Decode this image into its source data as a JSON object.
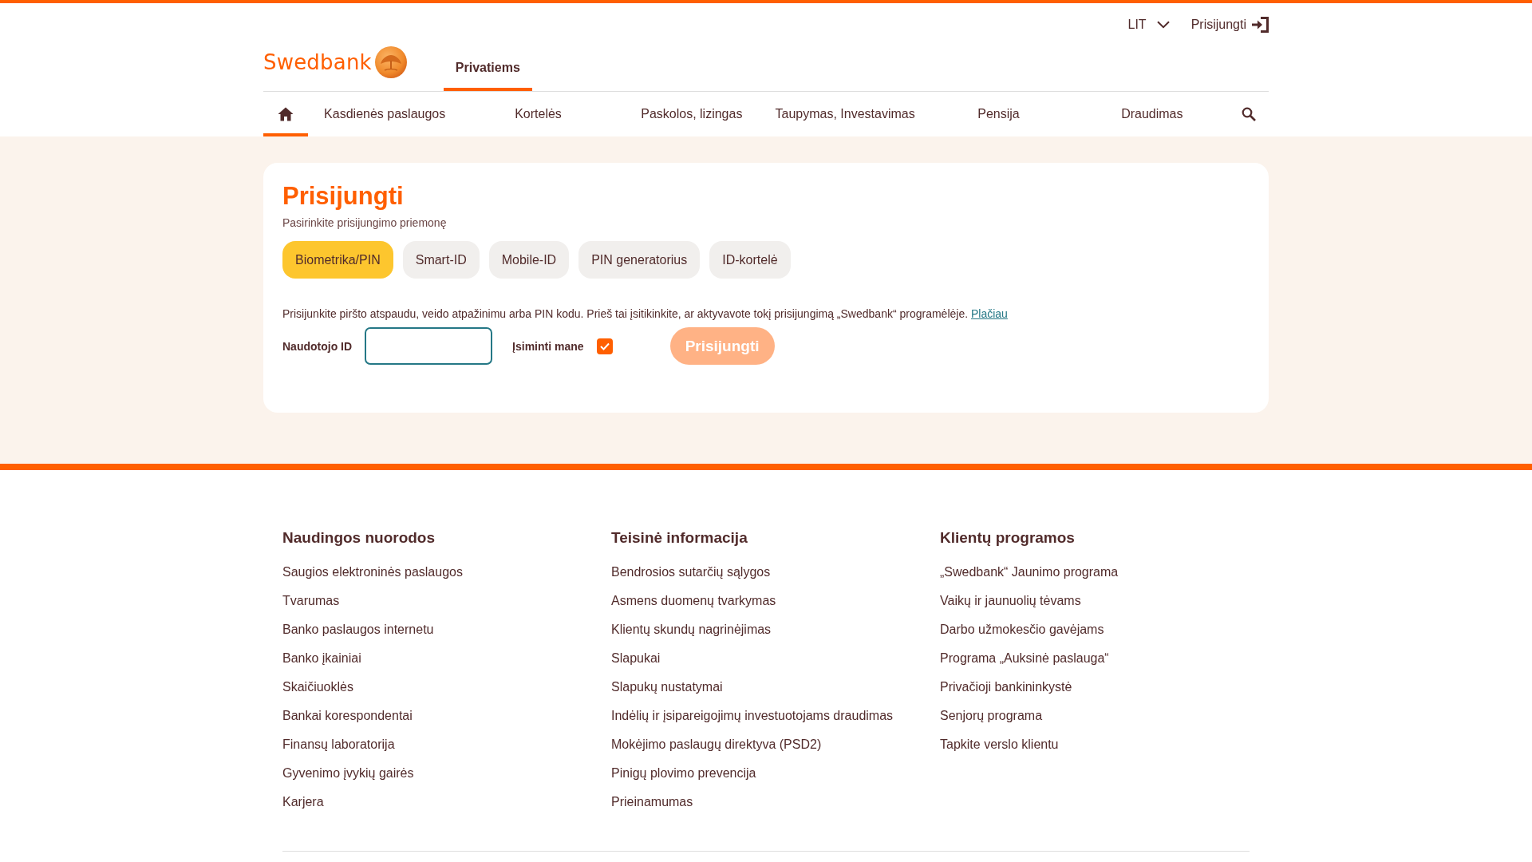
{
  "top_bar": {
    "language": "LIT",
    "login_link": "Prisijungti"
  },
  "brand": {
    "logo_text": "Swedbank"
  },
  "segment_tabs": [
    {
      "label": "Privatiems",
      "selected": true
    }
  ],
  "main_nav": {
    "home": {
      "selected": true
    },
    "items": [
      {
        "label": "Kasdienės paslaugos",
        "selected": false
      },
      {
        "label": "Kortelės",
        "selected": false
      },
      {
        "label": "Paskolos, lizingas",
        "selected": false
      },
      {
        "label": "Taupymas, Investavimas",
        "selected": false
      },
      {
        "label": "Pensija",
        "selected": false
      },
      {
        "label": "Draudimas",
        "selected": false
      }
    ]
  },
  "login": {
    "title": "Prisijungti",
    "subtitle": "Pasirinkite prisijungimo priemonę",
    "methods": [
      {
        "label": "Biometrika/PIN",
        "selected": true
      },
      {
        "label": "Smart-ID",
        "selected": false
      },
      {
        "label": "Mobile-ID",
        "selected": false
      },
      {
        "label": "PIN generatorius",
        "selected": false
      },
      {
        "label": "ID-kortelė",
        "selected": false
      }
    ],
    "description": "Prisijunkite piršto atspaudu, veido atpažinimu arba PIN kodu. Prieš tai įsitikinkite, ar aktyvavote tokį prisijungimą „Swedbank“ programėlėje.",
    "more_link": "Plačiau",
    "user_id": {
      "label": "Naudotojo ID"
    },
    "remember": {
      "label": "Įsiminti mane",
      "checked": true
    },
    "submit": {
      "label": "Prisijungti",
      "disabled": true
    }
  },
  "footer": {
    "columns": [
      {
        "title": "Naudingos nuorodos",
        "links": [
          "Saugios elektroninės paslaugos",
          "Tvarumas",
          "Banko paslaugos internetu",
          "Banko įkainiai",
          "Skaičiuoklės",
          "Bankai korespondentai",
          "Finansų laboratorija",
          "Gyvenimo įvykių gairės",
          "Karjera"
        ]
      },
      {
        "title": "Teisinė informacija",
        "links": [
          "Bendrosios sutarčių sąlygos",
          "Asmens duomenų tvarkymas",
          "Klientų skundų nagrinėjimas",
          "Slapukai",
          "Slapukų nustatymai",
          "Indėlių ir įsipareigojimų investuotojams draudimas",
          "Mokėjimo paslaugų direktyva (PSD2)",
          "Pinigų plovimo prevencija",
          "Prieinamumas"
        ]
      },
      {
        "title": "Klientų programos",
        "links": [
          "„Swedbank“ Jaunimo programa",
          "Vaikų ir jaunuolių tėvams",
          "Darbo užmokesčio gavėjams",
          "Programa „Auksinė paslauga“",
          "Privačioji bankininkystė",
          "Senjorų programa",
          "Tapkite verslo klientu"
        ]
      }
    ]
  }
}
